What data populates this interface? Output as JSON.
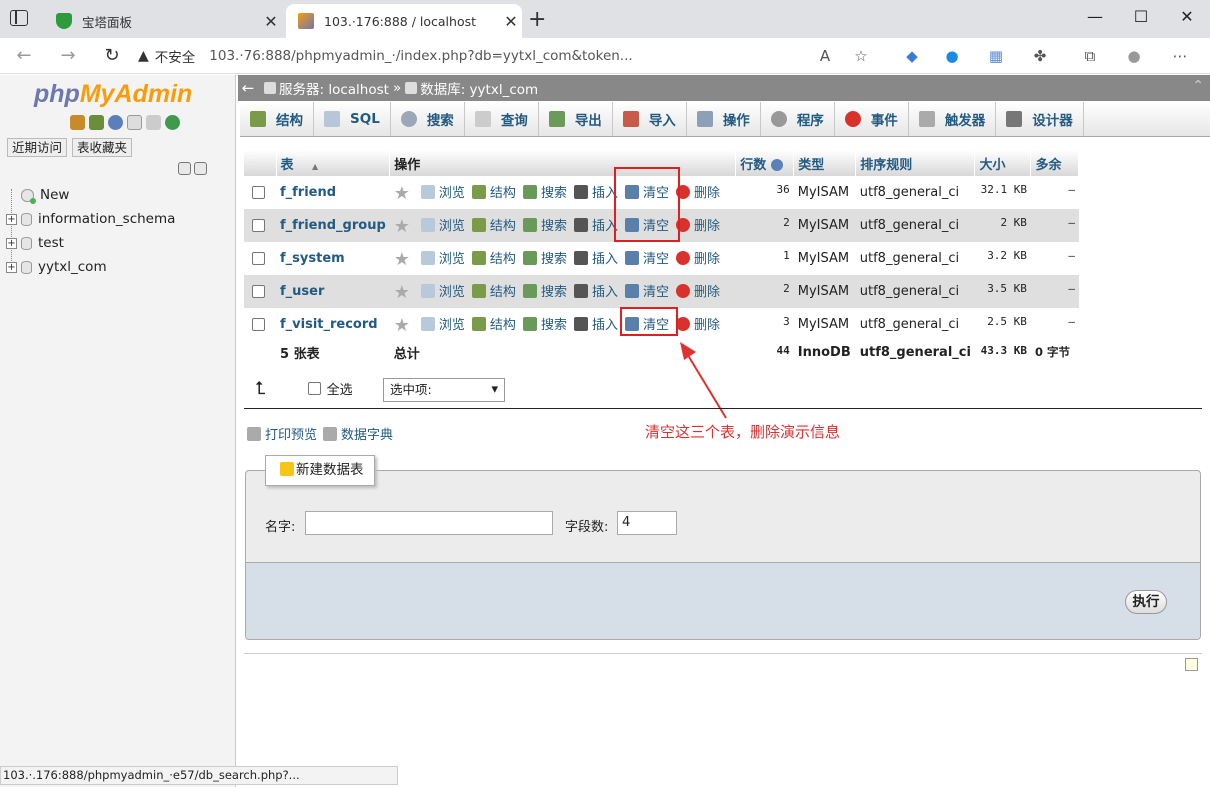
{
  "browser": {
    "tabs": [
      {
        "title": "宝塔面板",
        "active": false
      },
      {
        "title": "103.·176:888 / localhost",
        "active": true
      }
    ],
    "security_label": "不安全",
    "url": "103.·76:888/phpmyadmin_·/index.php?db=yytxl_com&token...",
    "window_controls": {
      "minimize": "—",
      "maximize": "☐",
      "close": "✕"
    },
    "status_url": "103.·.176:888/phpmyadmin_·e57/db_search.php?..."
  },
  "sidebar": {
    "logo_php": "php",
    "logo_myadmin": "MyAdmin",
    "recent_label": "近期访问",
    "favorites_label": "表收藏夹",
    "tree": [
      {
        "label": "New",
        "type": "new"
      },
      {
        "label": "information_schema",
        "type": "db"
      },
      {
        "label": "test",
        "type": "db"
      },
      {
        "label": "yytxl_com",
        "type": "db"
      }
    ]
  },
  "breadcrumb": {
    "server": "服务器: localhost",
    "separator": "»",
    "database": "数据库: yytxl_com"
  },
  "menu": {
    "tabs": [
      "结构",
      "SQL",
      "搜索",
      "查询",
      "导出",
      "导入",
      "操作",
      "程序",
      "事件",
      "触发器",
      "设计器"
    ]
  },
  "table_list": {
    "headers": {
      "table": "表",
      "sort_arrow": "▲",
      "actions": "操作",
      "rows": "行数",
      "type": "类型",
      "collation": "排序规则",
      "size": "大小",
      "overhead": "多余"
    },
    "action_labels": {
      "browse": "浏览",
      "structure": "结构",
      "search": "搜索",
      "insert": "插入",
      "empty": "清空",
      "drop": "删除"
    },
    "rows": [
      {
        "name": "f_friend",
        "rows": "36",
        "type": "MyISAM",
        "collation": "utf8_general_ci",
        "size": "32.1 KB",
        "overhead": "–"
      },
      {
        "name": "f_friend_group",
        "rows": "2",
        "type": "MyISAM",
        "collation": "utf8_general_ci",
        "size": "2 KB",
        "overhead": "–"
      },
      {
        "name": "f_system",
        "rows": "1",
        "type": "MyISAM",
        "collation": "utf8_general_ci",
        "size": "3.2 KB",
        "overhead": "–"
      },
      {
        "name": "f_user",
        "rows": "2",
        "type": "MyISAM",
        "collation": "utf8_general_ci",
        "size": "3.5 KB",
        "overhead": "–"
      },
      {
        "name": "f_visit_record",
        "rows": "3",
        "type": "MyISAM",
        "collation": "utf8_general_ci",
        "size": "2.5 KB",
        "overhead": "–"
      }
    ],
    "footer": {
      "count": "5 张表",
      "total": "总计",
      "rows": "44",
      "type": "InnoDB",
      "collation": "utf8_general_ci",
      "size": "43.3 KB",
      "overhead": "0 字节"
    }
  },
  "bulk": {
    "check_all": "全选",
    "with_selected": "选中项:"
  },
  "links": {
    "print": "打印预览",
    "dictionary": "数据字典"
  },
  "annotation": "清空这三个表，删除演示信息",
  "create_table": {
    "legend": "新建数据表",
    "name_label": "名字:",
    "name_value": "",
    "fields_label": "字段数:",
    "fields_value": "4",
    "go_label": "执行"
  },
  "colors": {
    "link": "#235a81",
    "highlight": "#e02020",
    "annotation": "#e03030"
  }
}
